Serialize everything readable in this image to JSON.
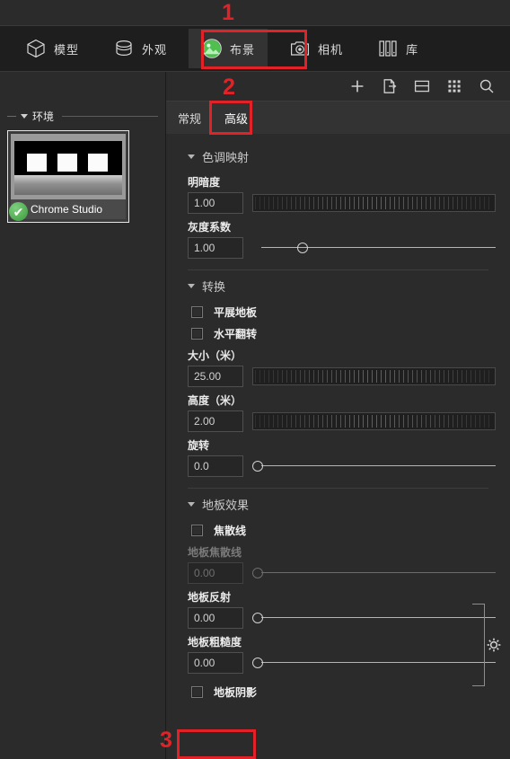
{
  "toolbar": {
    "items": [
      {
        "label": "模型",
        "icon": "cube-icon",
        "active": false
      },
      {
        "label": "外观",
        "icon": "cylinder-icon",
        "active": false
      },
      {
        "label": "布景",
        "icon": "scene-sphere-icon",
        "active": true
      },
      {
        "label": "相机",
        "icon": "camera-icon",
        "active": false
      },
      {
        "label": "库",
        "icon": "library-icon",
        "active": false
      }
    ]
  },
  "sidebar": {
    "group_title": "环境",
    "items": [
      {
        "name": "Chrome Studio",
        "selected": true,
        "check": "✔"
      }
    ]
  },
  "panel_toolbar": {
    "icons": [
      {
        "name": "add-icon",
        "title": "+"
      },
      {
        "name": "export-icon",
        "title": "export"
      },
      {
        "name": "layout-icon",
        "title": "layout"
      },
      {
        "name": "grid-icon",
        "title": "grid"
      },
      {
        "name": "search-icon",
        "title": "search"
      }
    ]
  },
  "tabs": [
    {
      "label": "常规",
      "active": false
    },
    {
      "label": "高级",
      "active": true
    }
  ],
  "sections": {
    "tone_mapping": {
      "title": "色调映射",
      "brightness": {
        "label": "明暗度",
        "value": "1.00",
        "control": "roller"
      },
      "gamma": {
        "label": "灰度系数",
        "value": "1.00",
        "control": "slider",
        "knob_pct": 23
      }
    },
    "transform": {
      "title": "转换",
      "checkboxes": [
        {
          "label": "平展地板",
          "checked": false
        },
        {
          "label": "水平翻转",
          "checked": false
        }
      ],
      "size": {
        "label": "大小（米）",
        "value": "25.00",
        "control": "roller"
      },
      "height": {
        "label": "高度（米）",
        "value": "2.00",
        "control": "roller"
      },
      "rotation": {
        "label": "旋转",
        "value": "0.0",
        "control": "slider",
        "knob_pct": 0
      }
    },
    "floor_effects": {
      "title": "地板效果",
      "caustics_checkbox": {
        "label": "焦散线",
        "checked": false
      },
      "floor_caustics": {
        "label": "地板焦散线",
        "value": "0.00",
        "control": "slider",
        "knob_pct": 0,
        "disabled": true
      },
      "floor_reflection": {
        "label": "地板反射",
        "value": "0.00",
        "control": "slider",
        "knob_pct": 0,
        "disabled": false
      },
      "floor_roughness": {
        "label": "地板粗糙度",
        "value": "0.00",
        "control": "slider",
        "knob_pct": 0,
        "disabled": false
      },
      "floor_shadow_checkbox": {
        "label": "地板阴影",
        "checked": false
      }
    }
  },
  "annotations": [
    {
      "number": "1",
      "target": "toolbar-item-scene"
    },
    {
      "number": "2",
      "target": "tab-advanced"
    },
    {
      "number": "3",
      "target": "floor-shadow-checkbox"
    }
  ],
  "colors": {
    "annotation_red": "#e32227",
    "panel_bg": "#2b2b2b",
    "toolbar_bg": "#1e1e1e",
    "accent_green": "#3a9a3a"
  }
}
